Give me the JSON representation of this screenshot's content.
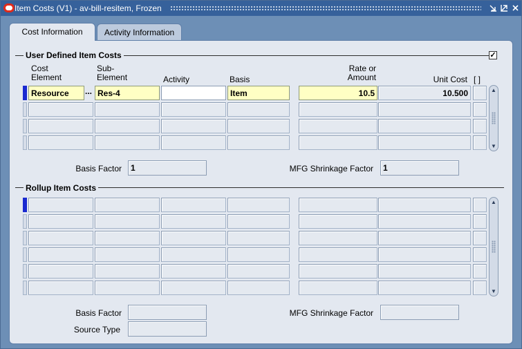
{
  "window": {
    "title": "Item Costs (V1) - av-bill-resitem, Frozen"
  },
  "tabs": [
    {
      "label": "Cost Information",
      "active": true
    },
    {
      "label": "Activity Information",
      "active": false
    }
  ],
  "user_defined": {
    "title": "User Defined Item Costs",
    "checkbox_checked": "✓",
    "headers": {
      "cost_element": "Cost\nElement",
      "sub_element": "Sub-\nElement",
      "activity": "Activity",
      "basis": "Basis",
      "rate": "Rate or\nAmount",
      "unit_cost": "Unit Cost",
      "folder": "[  ]"
    },
    "rows": [
      {
        "cost_element": "Resource",
        "sub_element": "Res-4",
        "activity": "",
        "basis": "Item",
        "rate": "10.5",
        "unit_cost": "10.500"
      },
      {
        "cost_element": "",
        "sub_element": "",
        "activity": "",
        "basis": "",
        "rate": "",
        "unit_cost": ""
      },
      {
        "cost_element": "",
        "sub_element": "",
        "activity": "",
        "basis": "",
        "rate": "",
        "unit_cost": ""
      },
      {
        "cost_element": "",
        "sub_element": "",
        "activity": "",
        "basis": "",
        "rate": "",
        "unit_cost": ""
      }
    ],
    "basis_factor_label": "Basis Factor",
    "basis_factor_value": "1",
    "mfg_shrinkage_label": "MFG Shrinkage Factor",
    "mfg_shrinkage_value": "1"
  },
  "rollup": {
    "title": "Rollup Item Costs",
    "basis_factor_label": "Basis Factor",
    "basis_factor_value": "",
    "mfg_shrinkage_label": "MFG Shrinkage Factor",
    "mfg_shrinkage_value": "",
    "source_type_label": "Source Type",
    "source_type_value": ""
  },
  "lov_glyph": "...",
  "colors": {
    "title_bar": "#36619b",
    "background": "#6d8fb6",
    "panel": "#e3e8f0",
    "required_field": "#ffffc4",
    "current_record": "#1a2ad0"
  }
}
